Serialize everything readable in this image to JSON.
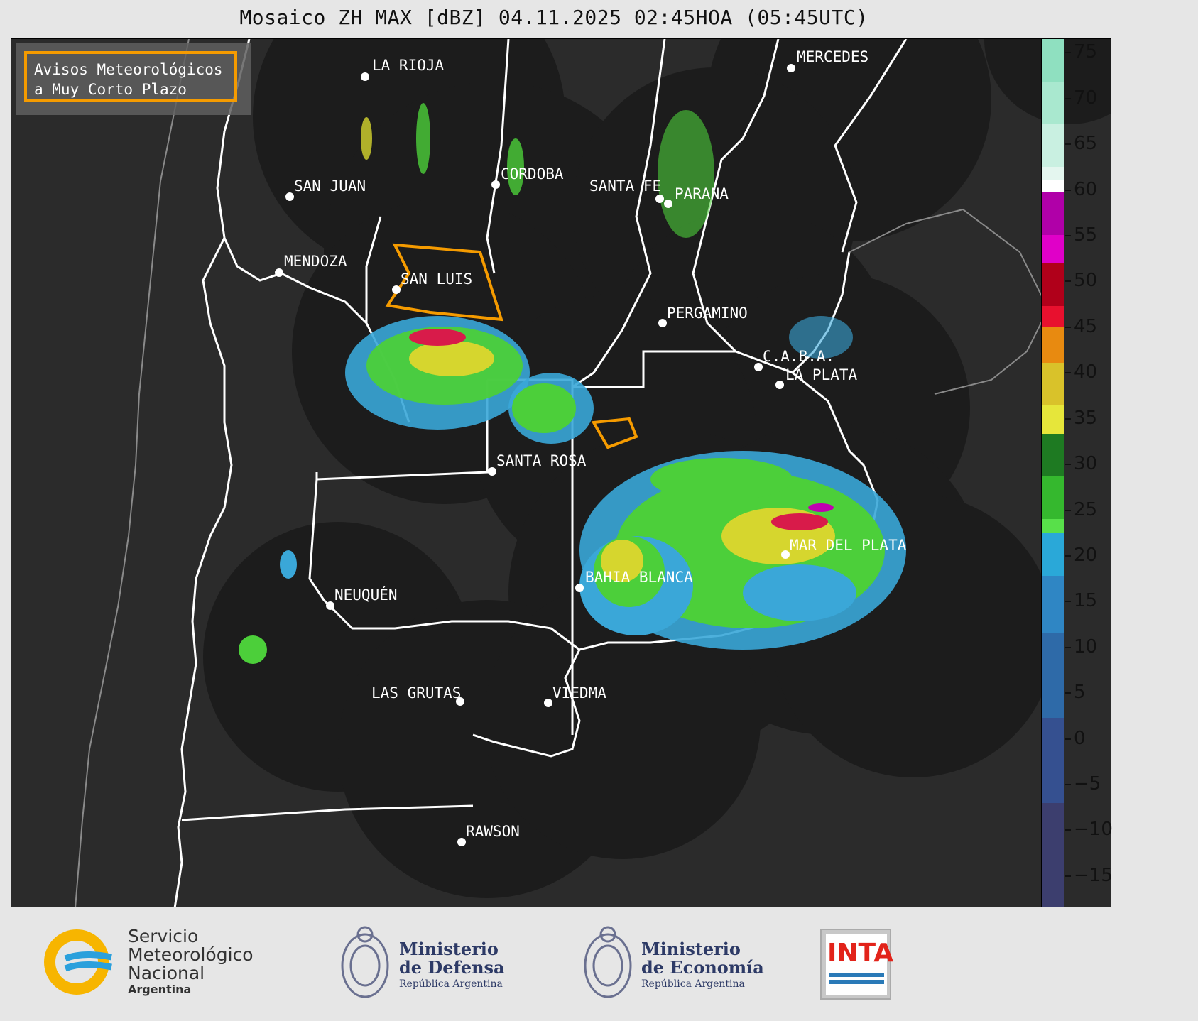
{
  "title": "Mosaico ZH MAX [dBZ] 04.11.2025 02:45HOA (05:45UTC)",
  "legend": {
    "line1": "Avisos Meteorológicos",
    "line2": "a Muy Corto Plazo",
    "color": "#f59b00"
  },
  "cities": [
    {
      "name": "LA RIOJA"
    },
    {
      "name": "MERCEDES"
    },
    {
      "name": "SAN JUAN"
    },
    {
      "name": "CORDOBA"
    },
    {
      "name": "SANTA FE"
    },
    {
      "name": "PARANA"
    },
    {
      "name": "MENDOZA"
    },
    {
      "name": "SAN LUIS"
    },
    {
      "name": "PERGAMINO"
    },
    {
      "name": "C.A.B.A."
    },
    {
      "name": "LA PLATA"
    },
    {
      "name": "SANTA ROSA"
    },
    {
      "name": "MAR DEL PLATA"
    },
    {
      "name": "BAHIA BLANCA"
    },
    {
      "name": "NEUQUÉN"
    },
    {
      "name": "LAS GRUTAS"
    },
    {
      "name": "VIEDMA"
    },
    {
      "name": "RAWSON"
    }
  ],
  "colorbar": {
    "ticks": [
      "75",
      "70",
      "65",
      "60",
      "55",
      "50",
      "45",
      "40",
      "35",
      "30",
      "25",
      "20",
      "15",
      "10",
      "5",
      "0",
      "−5",
      "−10",
      "−15"
    ],
    "range": [
      -18.5,
      76.5
    ]
  },
  "footer": {
    "smn": {
      "line1": "Servicio",
      "line2": "Meteorológico",
      "line3": "Nacional",
      "line4": "Argentina"
    },
    "defensa": {
      "line1": "Ministerio",
      "line2": "de Defensa",
      "line3": "República Argentina"
    },
    "economia": {
      "line1": "Ministerio",
      "line2": "de Economía",
      "line3": "República Argentina"
    },
    "inta": {
      "label": "INTA"
    }
  }
}
